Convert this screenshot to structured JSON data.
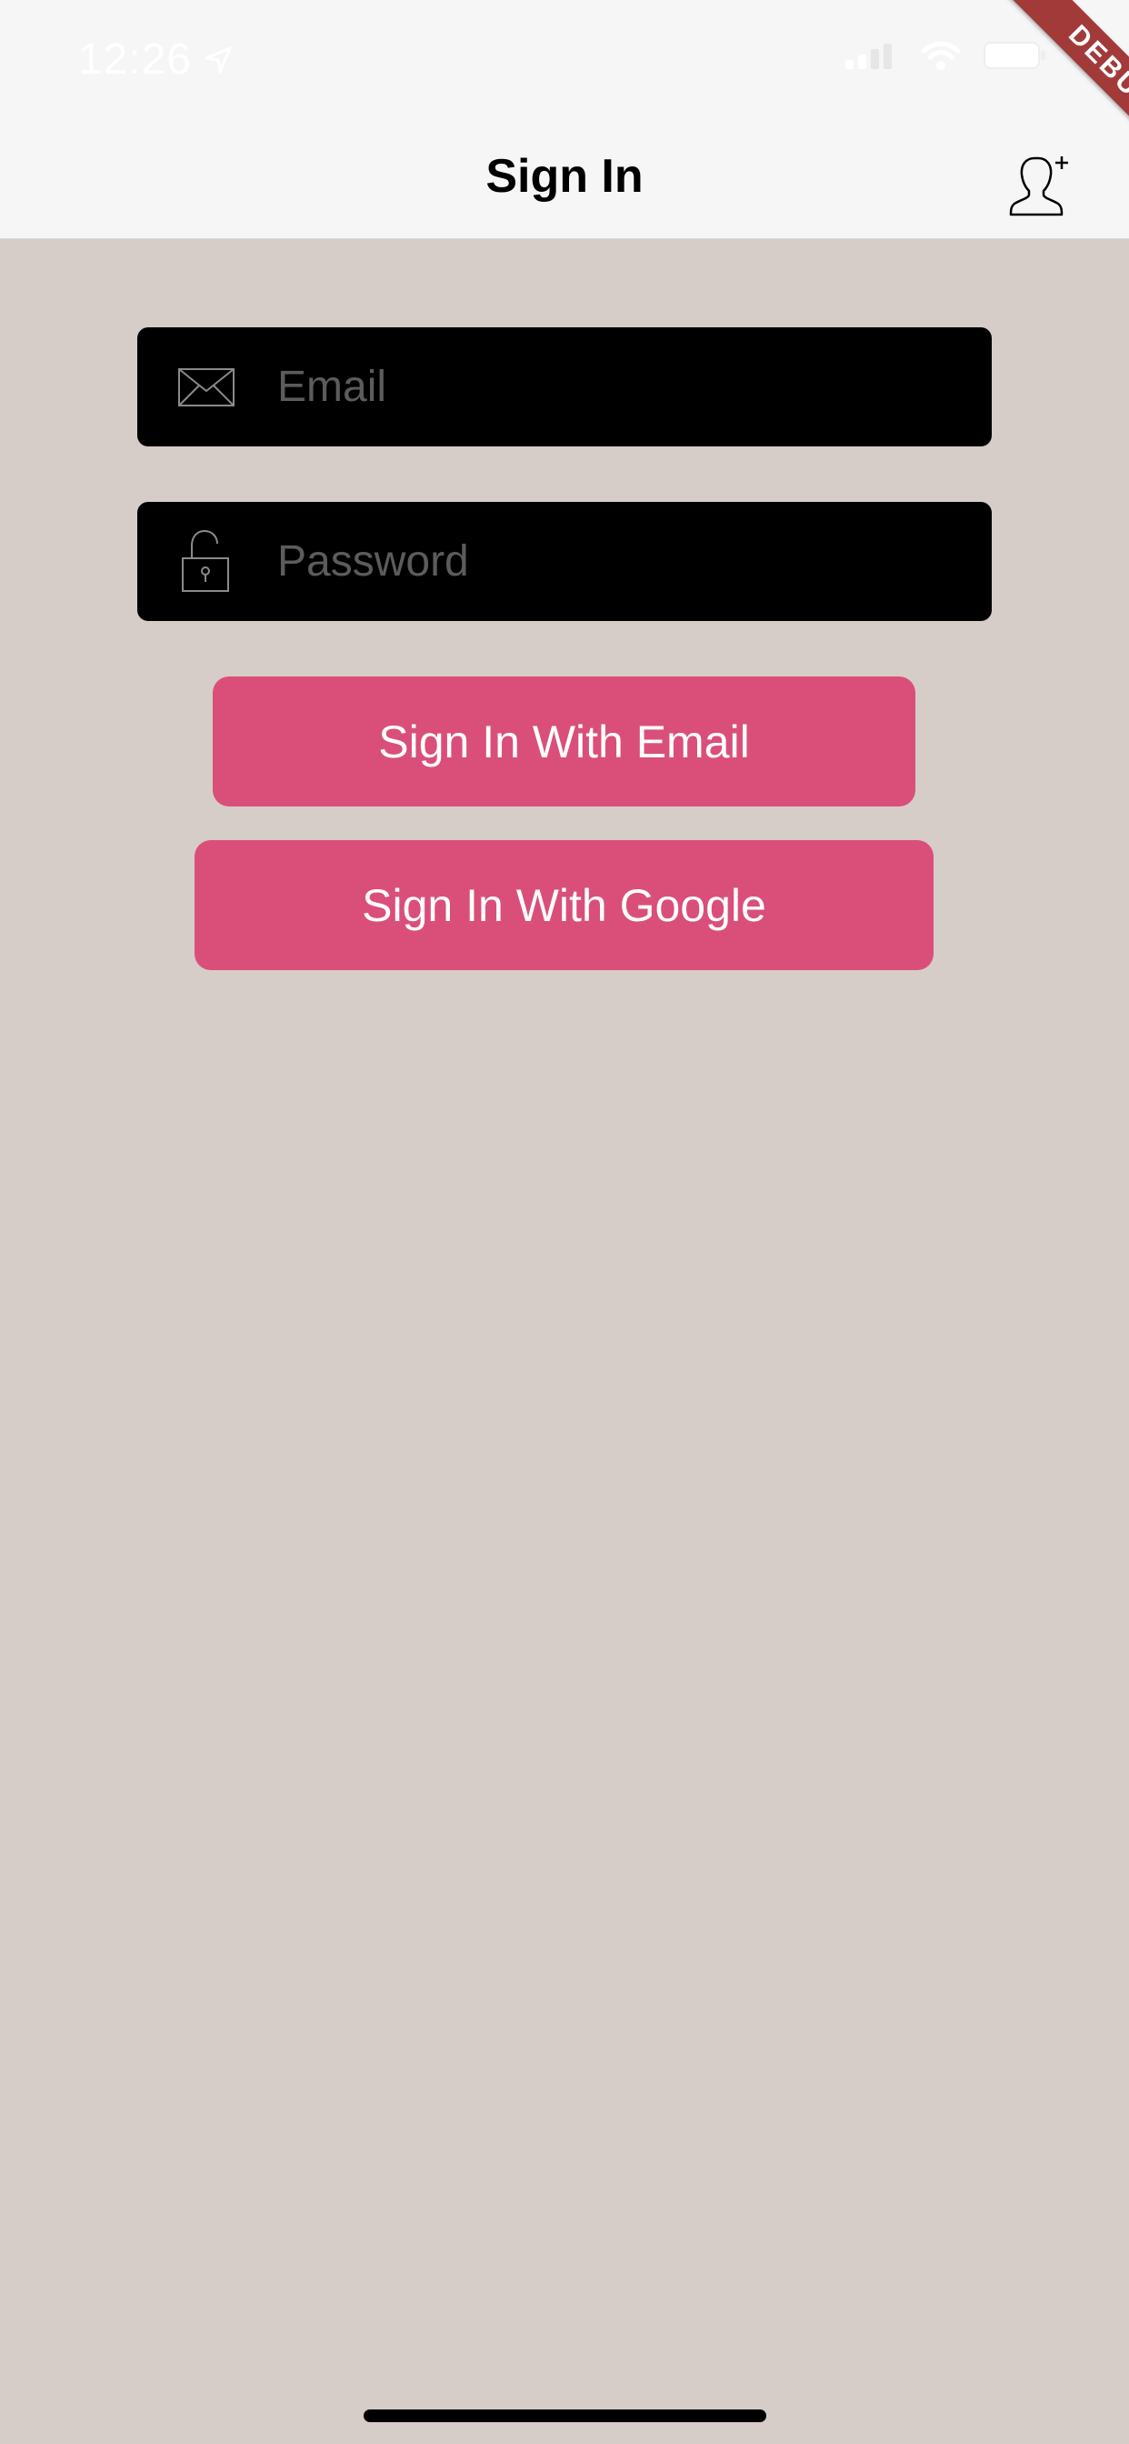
{
  "status_bar": {
    "time": "12:26",
    "icons": [
      "location-arrow-icon",
      "signal-icon",
      "wifi-icon",
      "battery-icon"
    ]
  },
  "debug_banner": "DEBUG",
  "nav": {
    "title": "Sign In",
    "action_icon": "add-user-icon"
  },
  "form": {
    "email_placeholder": "Email",
    "email_icon": "envelope-icon",
    "password_placeholder": "Password",
    "password_icon": "unlock-icon"
  },
  "buttons": {
    "email_label": "Sign In With Email",
    "google_label": "Sign In With Google"
  },
  "colors": {
    "background": "#d6ccc8",
    "header": "#f6f6f6",
    "field": "#000000",
    "button": "#da4f7a",
    "debug_ribbon": "#a33a3a"
  }
}
